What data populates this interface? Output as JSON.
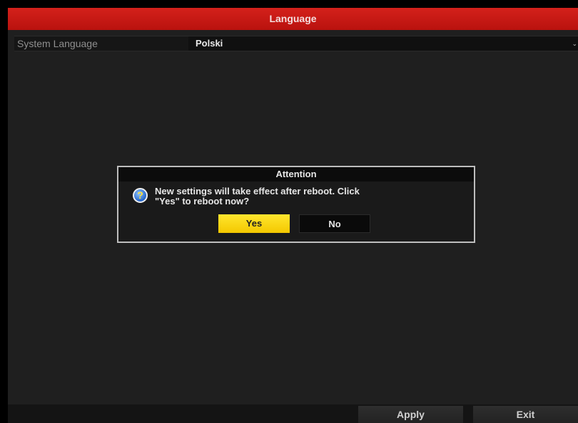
{
  "window": {
    "title": "Language"
  },
  "settings": {
    "system_language_label": "System Language",
    "system_language_value": "Polski"
  },
  "dialog": {
    "title": "Attention",
    "message_line1": "New settings will take effect after reboot. Click",
    "message_line2": "\"Yes\" to reboot now?",
    "icon": "question-icon",
    "yes_label": "Yes",
    "no_label": "No"
  },
  "footer": {
    "apply_label": "Apply",
    "exit_label": "Exit"
  },
  "colors": {
    "title_bar": "#c8161b",
    "button_highlight": "#ffd800",
    "background": "#1f1f1f"
  }
}
